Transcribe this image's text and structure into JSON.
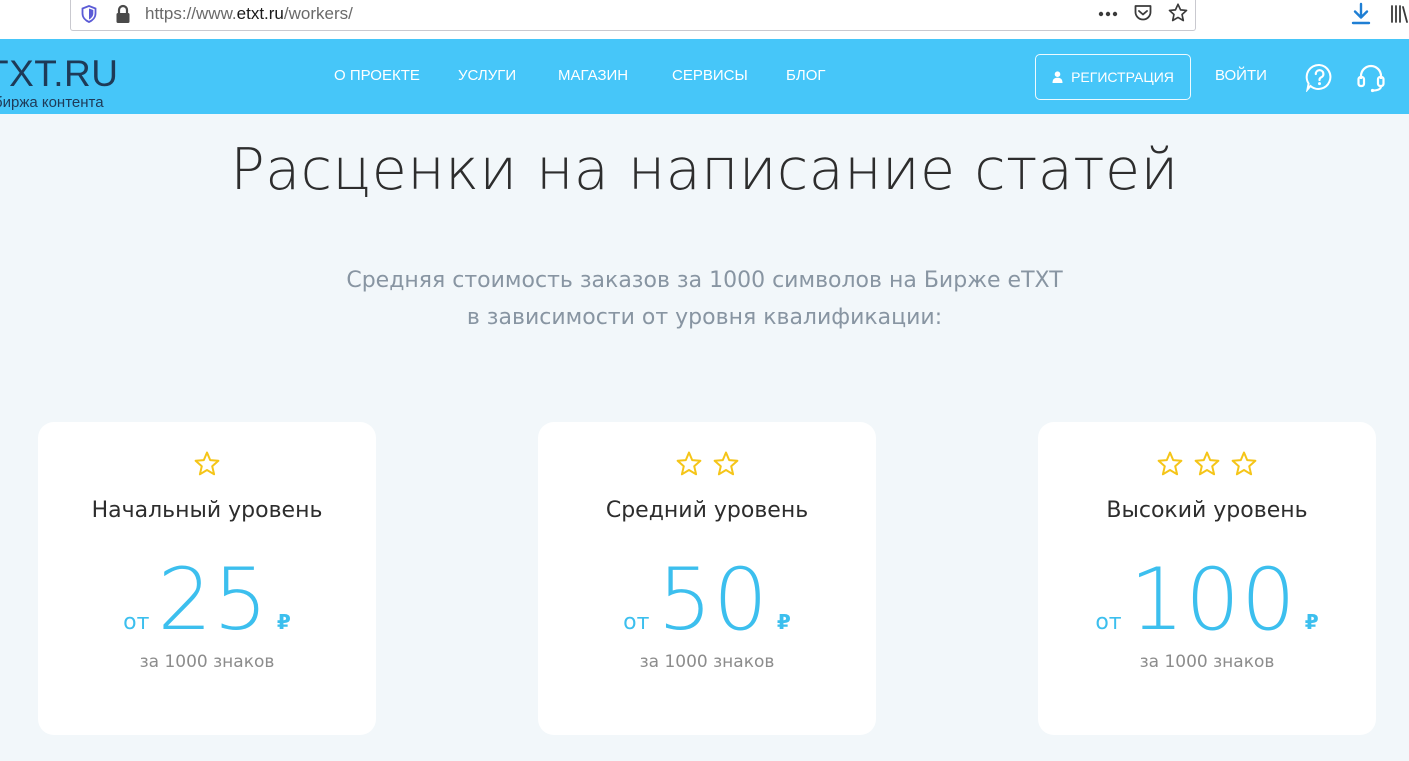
{
  "browser": {
    "url_prefix": "https://www.",
    "url_host": "etxt.ru",
    "url_path": "/workers/",
    "icons": [
      "shield-icon",
      "lock-icon",
      "dots-icon",
      "pocket-icon",
      "bookmark-icon",
      "download-icon",
      "library-icon"
    ]
  },
  "header": {
    "logo": "TXT.RU",
    "logo_sub": "биржа контента",
    "nav": [
      "О ПРОЕКТЕ",
      "УСЛУГИ",
      "МАГАЗИН",
      "СЕРВИСЫ",
      "БЛОГ"
    ],
    "register_label": "РЕГИСТРАЦИЯ",
    "login_label": "ВОЙТИ",
    "icons": [
      "person-icon",
      "help-icon",
      "headset-icon"
    ]
  },
  "main": {
    "title": "Расценки на написание статей",
    "subtitle_line1": "Средняя стоимость заказов за 1000 символов на Бирже eTXT",
    "subtitle_line2": "в зависимости от уровня квалификации:",
    "cards": [
      {
        "stars": 1,
        "name": "Начальный уровень",
        "from": "от",
        "price": "25",
        "currency": "₽",
        "per": "за 1000 знаков"
      },
      {
        "stars": 2,
        "name": "Средний уровень",
        "from": "от",
        "price": "50",
        "currency": "₽",
        "per": "за 1000 знаков"
      },
      {
        "stars": 3,
        "name": "Высокий уровень",
        "from": "от",
        "price": "100",
        "currency": "₽",
        "per": "за 1000 знаков"
      }
    ]
  },
  "colors": {
    "header_bg": "#46c6f9",
    "accent": "#3cbfee",
    "star": "#f5c518",
    "page_bg": "#f2f7fa"
  }
}
